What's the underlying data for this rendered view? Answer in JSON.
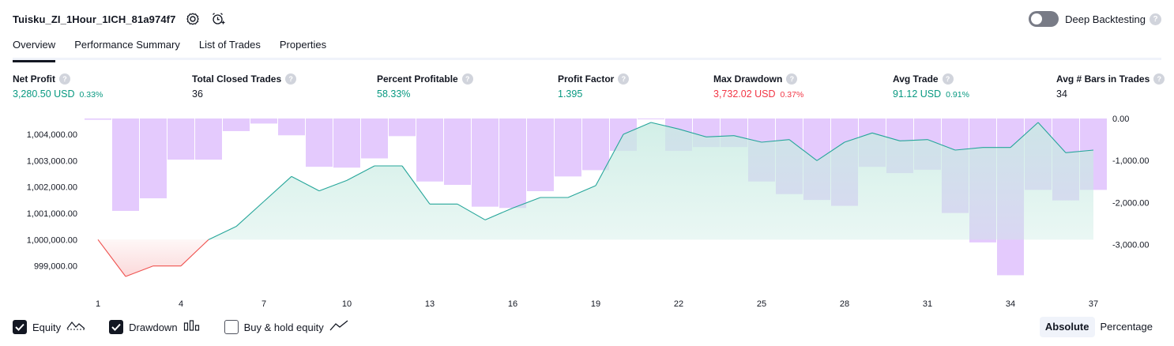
{
  "header": {
    "strategy_name": "Tuisku_ZI_1Hour_1ICH_81a974f7",
    "deep_backtesting_label": "Deep Backtesting",
    "deep_backtesting_enabled": false,
    "help_glyph": "?"
  },
  "tabs": [
    {
      "label": "Overview",
      "active": true
    },
    {
      "label": "Performance Summary",
      "active": false
    },
    {
      "label": "List of Trades",
      "active": false
    },
    {
      "label": "Properties",
      "active": false
    }
  ],
  "metrics": {
    "net_profit": {
      "label": "Net Profit",
      "value": "3,280.50 USD",
      "pct": "0.33%"
    },
    "total_closed_trades": {
      "label": "Total Closed Trades",
      "value": "36"
    },
    "percent_profitable": {
      "label": "Percent Profitable",
      "value": "58.33%"
    },
    "profit_factor": {
      "label": "Profit Factor",
      "value": "1.395"
    },
    "max_drawdown": {
      "label": "Max Drawdown",
      "value": "3,732.02 USD",
      "pct": "0.37%"
    },
    "avg_trade": {
      "label": "Avg Trade",
      "value": "91.12 USD",
      "pct": "0.91%"
    },
    "avg_bars": {
      "label": "Avg # Bars in Trades",
      "value": "34"
    }
  },
  "colors": {
    "positive": "#089981",
    "negative": "#f23645",
    "drawdown_bar": "#e1c4fd",
    "equity_line": "#26a69a",
    "equity_fill": "#c8ebe2",
    "equity_neg_line": "#ef5350",
    "equity_neg_fill": "#fbd7d8"
  },
  "chart_data": {
    "type": "area",
    "x": [
      1,
      2,
      3,
      4,
      5,
      6,
      7,
      8,
      9,
      10,
      11,
      12,
      13,
      14,
      15,
      16,
      17,
      18,
      19,
      20,
      21,
      22,
      23,
      24,
      25,
      26,
      27,
      28,
      29,
      30,
      31,
      32,
      33,
      34,
      35,
      36,
      37
    ],
    "x_ticks": [
      "1",
      "4",
      "7",
      "10",
      "13",
      "16",
      "19",
      "22",
      "25",
      "28",
      "31",
      "34",
      "37"
    ],
    "left_axis_ticks": [
      "1,004,000.00",
      "1,003,000.00",
      "1,002,000.00",
      "1,001,000.00",
      "1,000,000.00",
      "999,000.00"
    ],
    "right_axis_ticks": [
      "0.00",
      "-1,000.00",
      "-2,000.00",
      "-3,000.00"
    ],
    "left_ylim": [
      998300,
      1004600
    ],
    "right_ylim": [
      -3950,
      0
    ],
    "baseline": 1000000,
    "series": [
      {
        "name": "Equity",
        "axis": "left",
        "values": [
          1000000,
          998600,
          999000,
          999000,
          1000000,
          1000500,
          1001450,
          1002400,
          1001850,
          1002250,
          1002800,
          1002800,
          1001350,
          1001350,
          1000750,
          1001200,
          1001600,
          1001600,
          1002050,
          1004000,
          1004450,
          1004200,
          1003900,
          1003950,
          1003700,
          1003800,
          1003000,
          1003700,
          1004050,
          1003750,
          1003800,
          1003400,
          1003500,
          1003500,
          1004450,
          1003300,
          1003400
        ]
      },
      {
        "name": "Drawdown",
        "axis": "right",
        "type": "bar",
        "values": [
          -30,
          -2200,
          -1900,
          -980,
          -980,
          -300,
          -120,
          -400,
          -1150,
          -1170,
          -950,
          -420,
          -1500,
          -1580,
          -2100,
          -2130,
          -1730,
          -1380,
          -1230,
          -770,
          -20,
          -770,
          -680,
          -680,
          -1500,
          -1800,
          -1940,
          -2080,
          -1150,
          -1300,
          -1220,
          -2250,
          -2950,
          -3732,
          -1700,
          -1950,
          -1700
        ]
      }
    ],
    "legend": [
      {
        "label": "Equity",
        "checked": true,
        "icon": "equity-icon"
      },
      {
        "label": "Drawdown",
        "checked": true,
        "icon": "drawdown-icon"
      },
      {
        "label": "Buy & hold equity",
        "checked": false,
        "icon": "buy-hold-icon"
      }
    ]
  },
  "display_modes": [
    {
      "label": "Absolute",
      "active": true
    },
    {
      "label": "Percentage",
      "active": false
    }
  ]
}
